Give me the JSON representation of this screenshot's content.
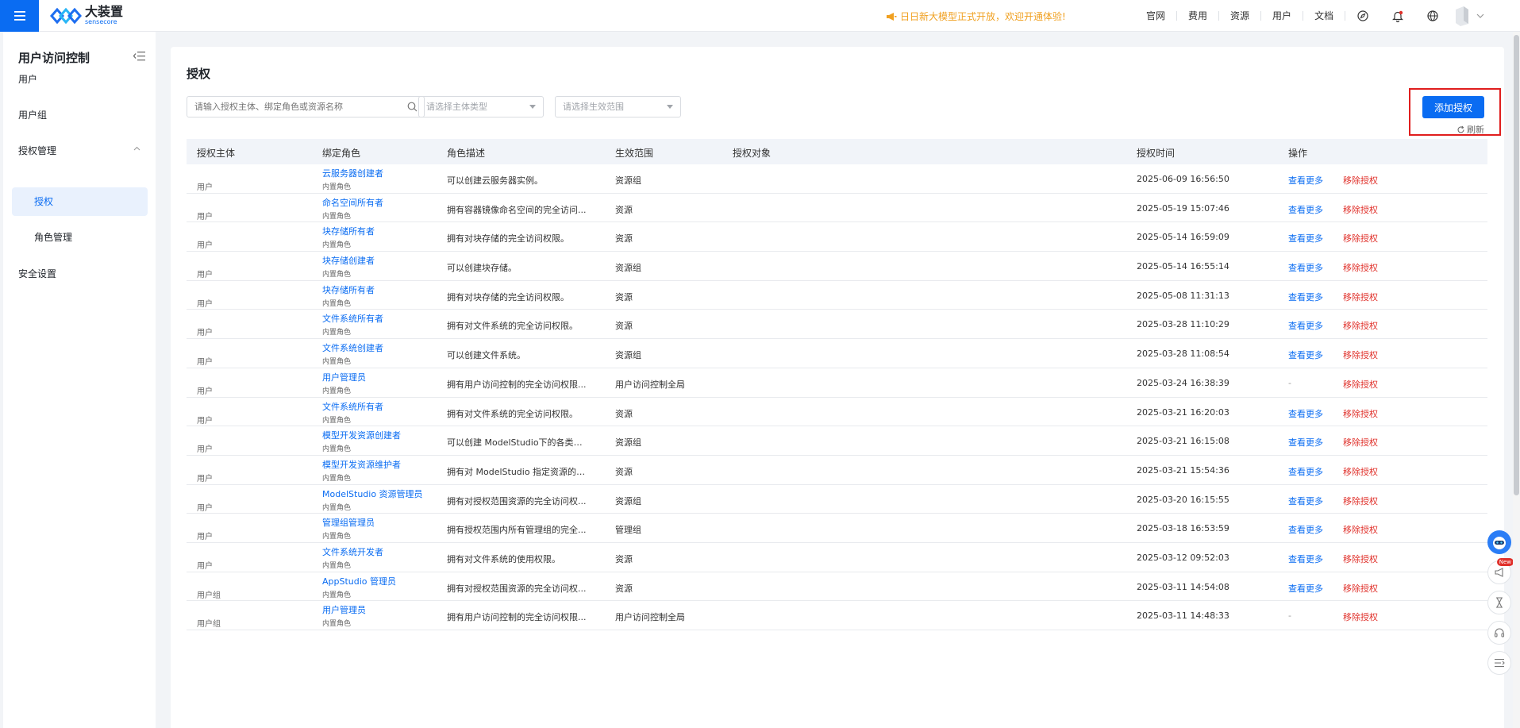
{
  "header": {
    "logo_cn": "大装置",
    "logo_en": "sensecore",
    "announcement": "日日新大模型正式开放，欢迎开通体验!",
    "nav": [
      "官网",
      "费用",
      "资源",
      "用户",
      "文档"
    ]
  },
  "sidebar": {
    "title": "用户访问控制",
    "items": {
      "users": "用户",
      "groups": "用户组",
      "auth_mgmt": "授权管理",
      "auth": "授权",
      "roles": "角色管理",
      "security": "安全设置"
    }
  },
  "main": {
    "title": "授权",
    "search_placeholder": "请输入授权主体、绑定角色或资源名称",
    "subject_type_placeholder": "请选择主体类型",
    "scope_placeholder": "请选择生效范围",
    "add_button": "添加授权",
    "refresh": "刷新"
  },
  "table": {
    "headers": {
      "subject": "授权主体",
      "role": "绑定角色",
      "desc": "角色描述",
      "scope": "生效范围",
      "target": "授权对象",
      "time": "授权时间",
      "ops": "操作"
    },
    "rows": [
      {
        "subject": "用户",
        "role": "云服务器创建者",
        "role_type": "内置角色",
        "desc": "可以创建云服务器实例。",
        "scope": "资源组",
        "time": "2025-06-09 16:56:50",
        "more": "查看更多",
        "remove": "移除授权"
      },
      {
        "subject": "用户",
        "role": "命名空间所有者",
        "role_type": "内置角色",
        "desc": "拥有容器镜像命名空间的完全访问...",
        "scope": "资源",
        "time": "2025-05-19 15:07:46",
        "more": "查看更多",
        "remove": "移除授权"
      },
      {
        "subject": "用户",
        "role": "块存储所有者",
        "role_type": "内置角色",
        "desc": "拥有对块存储的完全访问权限。",
        "scope": "资源",
        "time": "2025-05-14 16:59:09",
        "more": "查看更多",
        "remove": "移除授权"
      },
      {
        "subject": "用户",
        "role": "块存储创建者",
        "role_type": "内置角色",
        "desc": "可以创建块存储。",
        "scope": "资源组",
        "time": "2025-05-14 16:55:14",
        "more": "查看更多",
        "remove": "移除授权"
      },
      {
        "subject": "用户",
        "role": "块存储所有者",
        "role_type": "内置角色",
        "desc": "拥有对块存储的完全访问权限。",
        "scope": "资源",
        "time": "2025-05-08 11:31:13",
        "more": "查看更多",
        "remove": "移除授权"
      },
      {
        "subject": "用户",
        "role": "文件系统所有者",
        "role_type": "内置角色",
        "desc": "拥有对文件系统的完全访问权限。",
        "scope": "资源",
        "time": "2025-03-28 11:10:29",
        "more": "查看更多",
        "remove": "移除授权"
      },
      {
        "subject": "用户",
        "role": "文件系统创建者",
        "role_type": "内置角色",
        "desc": "可以创建文件系统。",
        "scope": "资源组",
        "time": "2025-03-28 11:08:54",
        "more": "查看更多",
        "remove": "移除授权"
      },
      {
        "subject": "用户",
        "role": "用户管理员",
        "role_type": "内置角色",
        "desc": "拥有用户访问控制的完全访问权限...",
        "scope": "用户访问控制全局",
        "time": "2025-03-24 16:38:39",
        "more": "-",
        "remove": "移除授权"
      },
      {
        "subject": "用户",
        "role": "文件系统所有者",
        "role_type": "内置角色",
        "desc": "拥有对文件系统的完全访问权限。",
        "scope": "资源",
        "time": "2025-03-21 16:20:03",
        "more": "查看更多",
        "remove": "移除授权"
      },
      {
        "subject": "用户",
        "role": "模型开发资源创建者",
        "role_type": "内置角色",
        "desc": "可以创建 ModelStudio下的各类资...",
        "scope": "资源组",
        "time": "2025-03-21 16:15:08",
        "more": "查看更多",
        "remove": "移除授权"
      },
      {
        "subject": "用户",
        "role": "模型开发资源维护者",
        "role_type": "内置角色",
        "desc": "拥有对 ModelStudio 指定资源的管...",
        "scope": "资源",
        "time": "2025-03-21 15:54:36",
        "more": "查看更多",
        "remove": "移除授权"
      },
      {
        "subject": "用户",
        "role": "ModelStudio 资源管理员",
        "role_type": "内置角色",
        "desc": "拥有对授权范围资源的完全访问权...",
        "scope": "资源组",
        "time": "2025-03-20 16:15:55",
        "more": "查看更多",
        "remove": "移除授权"
      },
      {
        "subject": "用户",
        "role": "管理组管理员",
        "role_type": "内置角色",
        "desc": "拥有授权范围内所有管理组的完全...",
        "scope": "管理组",
        "time": "2025-03-18 16:53:59",
        "more": "查看更多",
        "remove": "移除授权"
      },
      {
        "subject": "用户",
        "role": "文件系统开发者",
        "role_type": "内置角色",
        "desc": "拥有对文件系统的使用权限。",
        "scope": "资源",
        "time": "2025-03-12 09:52:03",
        "more": "查看更多",
        "remove": "移除授权"
      },
      {
        "subject": "用户组",
        "role": "AppStudio 管理员",
        "role_type": "内置角色",
        "desc": "拥有对授权范围资源的完全访问权...",
        "scope": "资源",
        "time": "2025-03-11 14:54:08",
        "more": "查看更多",
        "remove": "移除授权"
      },
      {
        "subject": "用户组",
        "role": "用户管理员",
        "role_type": "内置角色",
        "desc": "拥有用户访问控制的完全访问权限...",
        "scope": "用户访问控制全局",
        "time": "2025-03-11 14:48:33",
        "more": "-",
        "remove": "移除授权"
      }
    ]
  },
  "float_tools": {
    "new_badge": "New"
  },
  "colors": {
    "primary": "#0a6cf2",
    "danger": "#e0302a",
    "announce": "#f0a020",
    "highlight": "#e01e1e"
  }
}
